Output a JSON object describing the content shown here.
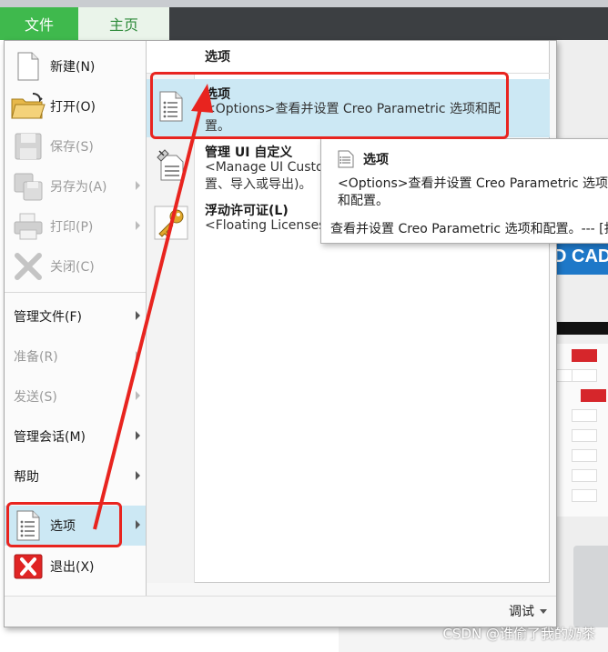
{
  "ribbon": {
    "tabs": [
      {
        "label": "文件"
      },
      {
        "label": "主页"
      }
    ]
  },
  "file_menu": {
    "items": [
      {
        "label": "新建(N)",
        "icon": "new-document-icon",
        "disabled": false
      },
      {
        "label": "打开(O)",
        "icon": "open-folder-icon",
        "disabled": false
      },
      {
        "label": "保存(S)",
        "icon": "save-icon",
        "disabled": true
      },
      {
        "label": "另存为(A)",
        "icon": "save-as-icon",
        "disabled": true
      },
      {
        "label": "打印(P)",
        "icon": "print-icon",
        "disabled": true
      },
      {
        "label": "关闭(C)",
        "icon": "close-icon",
        "disabled": true
      },
      {
        "label": "管理文件(F)",
        "disabled": false
      },
      {
        "label": "准备(R)",
        "disabled": true
      },
      {
        "label": "发送(S)",
        "disabled": true
      },
      {
        "label": "管理会话(M)",
        "disabled": false
      },
      {
        "label": "帮助",
        "disabled": false
      },
      {
        "label": "选项",
        "icon": "options-icon",
        "disabled": false,
        "selected": true
      },
      {
        "label": "退出(X)",
        "icon": "exit-icon",
        "disabled": false
      }
    ],
    "submenu": {
      "header": "选项",
      "items": [
        {
          "title": "选项",
          "description": "<Options>查看并设置 Creo Parametric 选项和配置。",
          "icon": "options-list-icon"
        },
        {
          "title": "管理 UI 自定义",
          "description": "<Manage UI Customizations>管理 UI 自定义 (重置、导入或导出)。",
          "icon": "ui-customize-icon"
        },
        {
          "title": "浮动许可证(L)",
          "description": "<Floating Licenses>",
          "icon": "license-key-icon"
        }
      ]
    },
    "footer": {
      "debug_label": "调试"
    }
  },
  "tooltip": {
    "title": "选项",
    "body": "<Options>查看并设置 Creo Parametric 选项和配置。",
    "footer": "查看并设置 Creo Parametric 选项和配置。--- [打开选项对话框]"
  },
  "background": {
    "banner_text": "D CAD"
  },
  "watermark": "CSDN @谁偷了我的奶茶",
  "colors": {
    "file_tab": "#3fb94d",
    "selection": "#cce8f4",
    "annotation": "#e8241f"
  }
}
